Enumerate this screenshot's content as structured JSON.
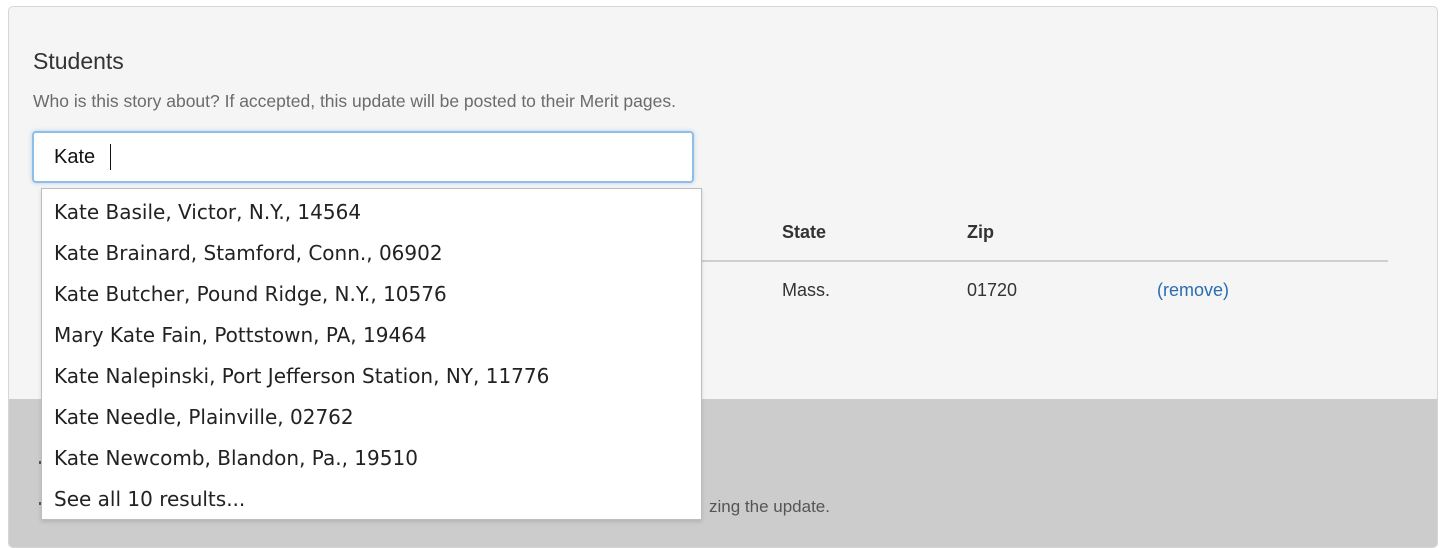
{
  "students": {
    "title": "Students",
    "help_text": "Who is this story about? If accepted, this update will be posted to their Merit pages.",
    "search": {
      "value": "Kate",
      "placeholder": ""
    }
  },
  "table": {
    "headers": [
      "State",
      "Zip"
    ],
    "row": {
      "state": "Mass.",
      "zip": "01720",
      "remove_label": "(remove)"
    }
  },
  "suggestions": [
    "Kate Basile, Victor, N.Y., 14564",
    "Kate Brainard, Stamford, Conn., 06902",
    "Kate Butcher, Pound Ridge, N.Y., 10576",
    "Mary Kate Fain, Pottstown, PA, 19464",
    "Kate Nalepinski, Port Jefferson Station, NY, 11776",
    "Kate Needle, Plainville, 02762",
    "Kate Newcomb, Blandon, Pa., 19510",
    "See all 10 results..."
  ],
  "lower_section": {
    "helper_fragment": "zing the update."
  },
  "colors": {
    "link": "#2a6db0",
    "input_focus_border": "#8fbfe6",
    "card_bg": "#f5f5f5",
    "lower_panel_bg": "#cccccc"
  }
}
